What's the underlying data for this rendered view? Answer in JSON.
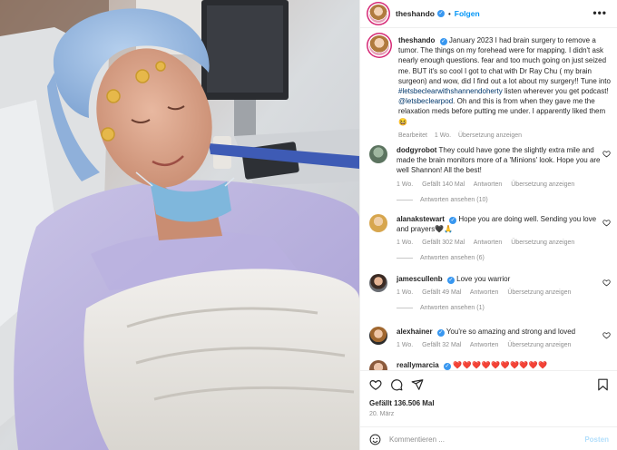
{
  "post": {
    "author": "theshando",
    "follow_label": "Folgen",
    "more_label": "•••",
    "caption_user": "theshando",
    "caption_pre": "January 2023 I had brain surgery to remove a tumor. The things on my forehead were for mapping. I didn't ask nearly enough questions. fear and too much going on just seized me. BUT it's so cool I got to chat with Dr Ray Chu ( my brain surgeon) and wow, did I find out a lot about my surgery!! Tune into ",
    "caption_hashtag": "#letsbeclearwithshannendoherty",
    "caption_mid": " listen wherever you get podcast! ",
    "caption_mention": "@letsbeclearpod",
    "caption_post": ". Oh and this is from when they gave me the relaxation meds before putting me under. I apparently liked them 😆",
    "caption_meta": {
      "edited": "Bearbeitet",
      "age": "1 Wo.",
      "translate": "Übersetzung anzeigen"
    }
  },
  "comments": [
    {
      "user": "dodgyrobot",
      "verified": false,
      "text": "They could have gone the slightly extra mile and made the brain monitors more of a 'Minions' look. Hope you are well Shannon! All the best!",
      "age": "1 Wo.",
      "likes": "Gefällt 140 Mal",
      "reply": "Antworten",
      "translate": "Übersetzung anzeigen",
      "replies": "Antworten ansehen (10)"
    },
    {
      "user": "alanakstewart",
      "verified": true,
      "text": "Hope you are doing well. Sending you love and prayers🖤🙏",
      "age": "1 Wo.",
      "likes": "Gefällt 302 Mal",
      "reply": "Antworten",
      "translate": "Übersetzung anzeigen",
      "replies": "Antworten ansehen (6)"
    },
    {
      "user": "jamescullenb",
      "verified": true,
      "text": "Love you warrior",
      "age": "1 Wo.",
      "likes": "Gefällt 49 Mal",
      "reply": "Antworten",
      "translate": "Übersetzung anzeigen",
      "replies": "Antworten ansehen (1)"
    },
    {
      "user": "alexhainer",
      "verified": true,
      "text": "You're so amazing and strong and loved",
      "age": "1 Wo.",
      "likes": "Gefällt 32 Mal",
      "reply": "Antworten",
      "translate": "Übersetzung anzeigen",
      "replies": ""
    },
    {
      "user": "reallymarcia",
      "verified": true,
      "text": "❤️❤️❤️❤️❤️❤️❤️❤️❤️❤️",
      "age": "",
      "likes": "",
      "reply": "",
      "translate": "",
      "replies": ""
    }
  ],
  "actions": {
    "likes": "Gefällt 136.506 Mal",
    "date": "20. März",
    "comment_placeholder": "Kommentieren ...",
    "post_label": "Posten"
  },
  "colors": {
    "accent": "#0095f6",
    "verified": "#3897f0",
    "heart_red": "#ed4956",
    "muted": "#8e8e8e"
  }
}
